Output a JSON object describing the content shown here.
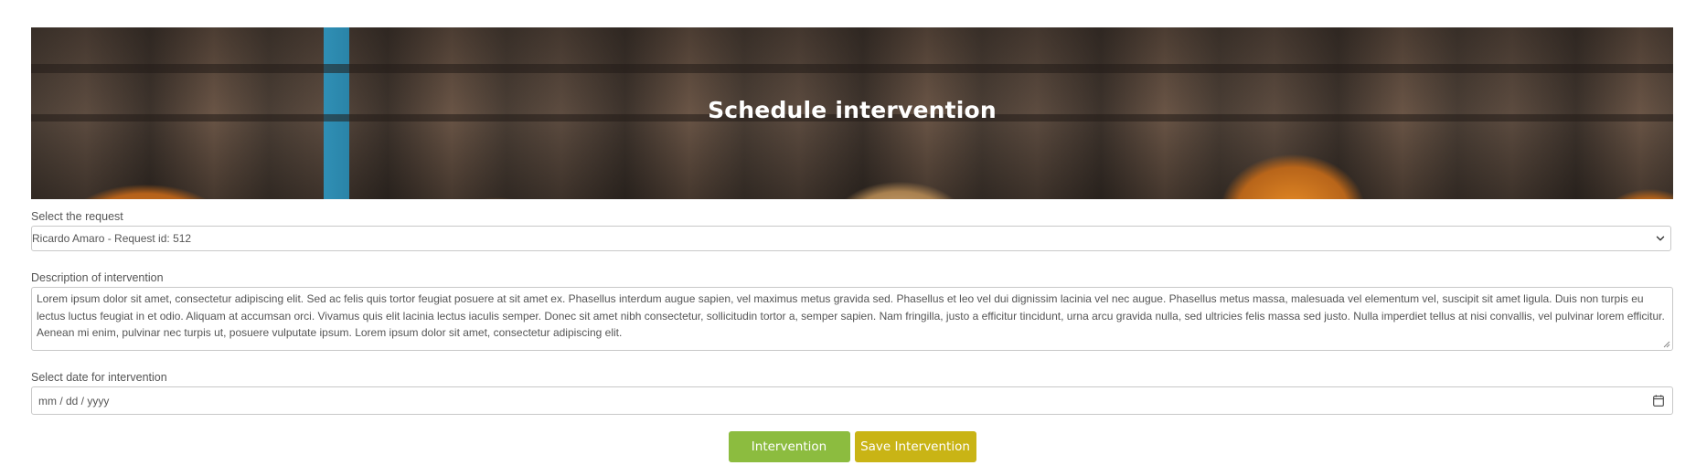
{
  "header": {
    "title": "Schedule intervention"
  },
  "form": {
    "request": {
      "label": "Select the request",
      "selected_value": "Ricardo Amaro - Request id: 512"
    },
    "description": {
      "label": "Description of intervention",
      "value": "Lorem ipsum dolor sit amet, consectetur adipiscing elit. Sed ac felis quis tortor feugiat posuere at sit amet ex. Phasellus interdum augue sapien, vel maximus metus gravida sed. Phasellus et leo vel dui dignissim lacinia vel nec augue. Phasellus metus massa, malesuada vel elementum vel, suscipit sit amet ligula. Duis non turpis eu lectus luctus feugiat in et odio. Aliquam at accumsan orci. Vivamus quis elit lacinia lectus iaculis semper. Donec sit amet nibh consectetur, sollicitudin tortor a, semper sapien. Nam fringilla, justo a efficitur tincidunt, urna arcu gravida nulla, sed ultricies felis massa sed justo. Nulla imperdiet tellus at nisi convallis, vel pulvinar lorem efficitur. Aenean mi enim, pulvinar nec turpis ut, posuere vulputate ipsum. Lorem ipsum dolor sit amet, consectetur adipiscing elit."
    },
    "date": {
      "label": "Select date for intervention",
      "placeholder": "mm / dd / yyyy"
    }
  },
  "actions": {
    "intervention_label": "Intervention",
    "save_label": "Save Intervention"
  },
  "icons": {
    "select_chevron": "chevron-down-icon",
    "calendar": "calendar-icon",
    "resize": "resize-grip-icon"
  },
  "colors": {
    "intervention_button": "#8cbc3f",
    "save_button": "#c9b415",
    "title_text": "#ffffff"
  }
}
